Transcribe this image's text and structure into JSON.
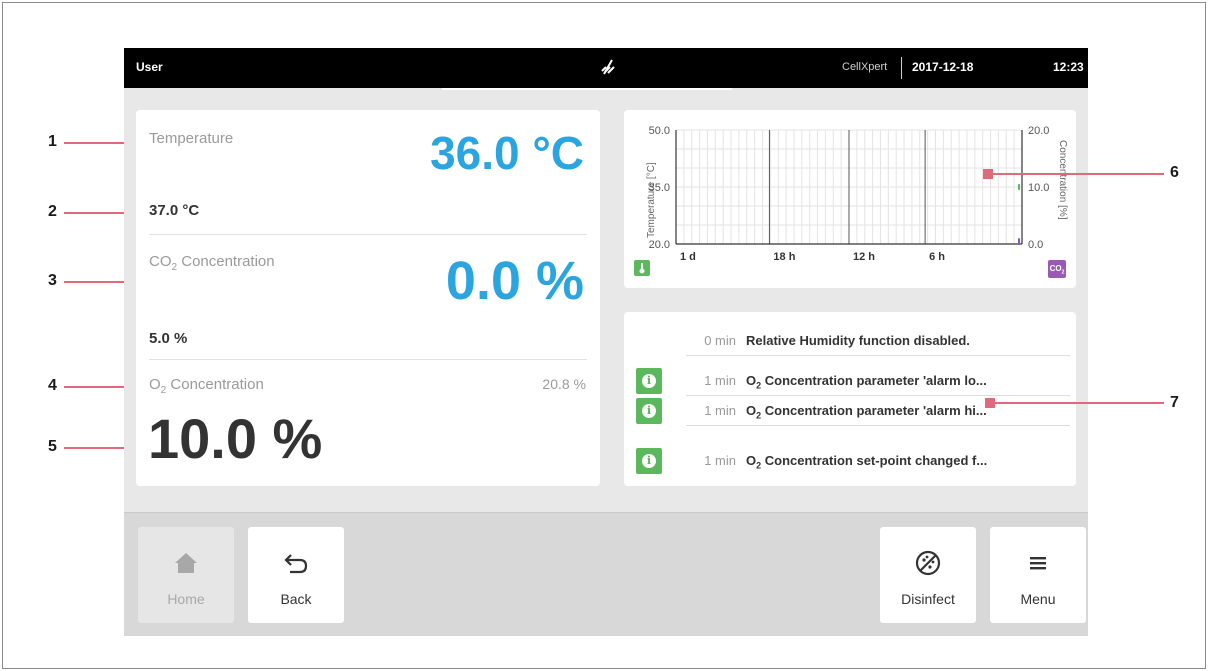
{
  "status_bar": {
    "user": "User",
    "brand": "CellXpert",
    "date": "2017-12-18",
    "time": "12:23"
  },
  "temperature": {
    "label": "Temperature",
    "actual": "36.0 °C",
    "setpoint": "37.0 °C"
  },
  "co2": {
    "label_main": "CO",
    "label_sub": "2",
    "label_rest": " Concentration",
    "actual": "0.0 %",
    "setpoint": "5.0 %"
  },
  "o2": {
    "label_main": "O",
    "label_sub": "2",
    "label_rest": " Concentration",
    "setpoint": "20.8 %",
    "actual": "10.0 %"
  },
  "chart": {
    "y_left_label": "Temperature [°C]",
    "y_left_ticks": [
      "50.0",
      "35.0",
      "20.0"
    ],
    "y_right_label": "Concentration [%]",
    "y_right_ticks": [
      "20.0",
      "10.0",
      "0.0"
    ],
    "x_ticks": [
      "1 d",
      "18 h",
      "12 h",
      "6 h"
    ],
    "co2_badge": "CO",
    "co2_badge_sub": "2",
    "colors": {
      "temperature_badge": "#5cb85c",
      "co2_badge": "#9b59b6",
      "series_green": "#5cb85c",
      "series_purple": "#7b5cc4"
    }
  },
  "chart_data": {
    "type": "line",
    "x": [
      "1 d",
      "18 h",
      "12 h",
      "6 h"
    ],
    "y_left": {
      "label": "Temperature [°C]",
      "ylim": [
        20.0,
        50.0
      ]
    },
    "y_right": {
      "label": "Concentration [%]",
      "ylim": [
        0.0,
        20.0
      ]
    },
    "grid": true
  },
  "log": {
    "items": [
      {
        "time": "0 min",
        "message": "Relative Humidity function disabled.",
        "icon": "none"
      },
      {
        "time": "1 min",
        "prefix": "O",
        "sub": "2",
        "message": " Concentration parameter 'alarm lo...",
        "icon": "info-icon"
      },
      {
        "time": "1 min",
        "prefix": "O",
        "sub": "2",
        "message": " Concentration parameter 'alarm hi...",
        "icon": "info-icon"
      },
      {
        "time": "1 min",
        "prefix": "O",
        "sub": "2",
        "message": " Concentration set-point changed f...",
        "icon": "info-icon"
      }
    ]
  },
  "buttons": {
    "home": "Home",
    "back": "Back",
    "disinfect": "Disinfect",
    "menu": "Menu"
  },
  "callouts": [
    "1",
    "2",
    "3",
    "4",
    "5",
    "6",
    "7"
  ]
}
